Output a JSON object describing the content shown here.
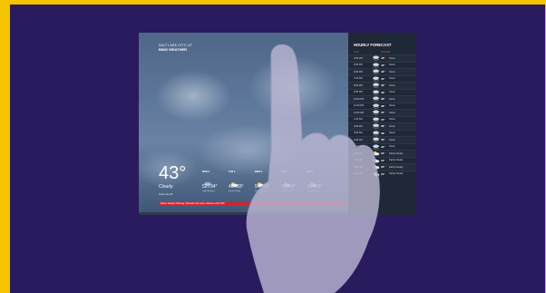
{
  "location": {
    "subtitle": "SALT LAKE CITY, UT",
    "title": "BING WEATHER"
  },
  "current": {
    "temp": "43°",
    "condition": "Cloudy",
    "details": "Feels Like 43°"
  },
  "days": [
    {
      "name": "MON 3",
      "temp": "52°/34°",
      "desc": "Light Showers",
      "icon": "rain-icon"
    },
    {
      "name": "TUE 4",
      "temp": "46°/33°",
      "desc": "Partly Cloudy",
      "icon": "partly-cloudy-icon"
    },
    {
      "name": "WED 5",
      "temp": "54°/40°",
      "desc": "Partly Cloudy",
      "icon": "partly-cloudy-icon"
    },
    {
      "name": "THU 6",
      "temp": "55°/36°",
      "desc": "Partly Cloudy",
      "icon": "partly-cloudy-icon"
    },
    {
      "name": "FRI 7",
      "temp": "63°/39°",
      "desc": "Partly Cloudy",
      "icon": "partly-cloudy-icon"
    }
  ],
  "alert": "Winter Weather Warning: Salt Lake City metro, effective until 5 PM",
  "hourly": {
    "title": "HOURLY FORECAST",
    "headers": [
      "Time",
      "Forecast"
    ],
    "rows": [
      {
        "time": "4:00 PM",
        "temp": "43°",
        "cond": "Snow",
        "icon": "snow-icon"
      },
      {
        "time": "5:00 PM",
        "temp": "43°",
        "cond": "Snow",
        "icon": "snow-icon"
      },
      {
        "time": "6:00 PM",
        "temp": "42°",
        "cond": "Snow",
        "icon": "snow-icon"
      },
      {
        "time": "7:00 PM",
        "temp": "41°",
        "cond": "Snow",
        "icon": "snow-icon"
      },
      {
        "time": "8:00 PM",
        "temp": "40°",
        "cond": "Snow",
        "icon": "snow-icon"
      },
      {
        "time": "9:00 PM",
        "temp": "39°",
        "cond": "Snow",
        "icon": "snow-icon"
      },
      {
        "time": "10:00 PM",
        "temp": "38°",
        "cond": "Snow",
        "icon": "snow-icon"
      },
      {
        "time": "11:00 PM",
        "temp": "38°",
        "cond": "Snow",
        "icon": "snow-icon"
      },
      {
        "time": "12:00 AM",
        "temp": "37°",
        "cond": "Snow",
        "icon": "snow-icon"
      },
      {
        "time": "1:00 AM",
        "temp": "37°",
        "cond": "Snow",
        "icon": "snow-icon"
      },
      {
        "time": "2:00 AM",
        "temp": "36°",
        "cond": "Snow",
        "icon": "snow-icon"
      },
      {
        "time": "3:00 AM",
        "temp": "36°",
        "cond": "Snow",
        "icon": "snow-icon"
      },
      {
        "time": "4:00 AM",
        "temp": "35°",
        "cond": "Snow",
        "icon": "snow-icon"
      },
      {
        "time": "5:00 AM",
        "temp": "35°",
        "cond": "Snow",
        "icon": "snow-icon"
      },
      {
        "time": "6:00 AM",
        "temp": "34°",
        "cond": "Partly Cloudy",
        "icon": "partly-cloudy-icon"
      },
      {
        "time": "7:00 AM",
        "temp": "34°",
        "cond": "Partly Cloudy",
        "icon": "partly-cloudy-icon"
      },
      {
        "time": "8:00 AM",
        "temp": "35°",
        "cond": "Partly Cloudy",
        "icon": "partly-cloudy-icon"
      },
      {
        "time": "9:00 AM",
        "temp": "37°",
        "cond": "Partly Cloudy",
        "icon": "partly-cloudy-icon"
      }
    ]
  },
  "colors": {
    "background": "#f5c400",
    "frame": "#2a1a5e",
    "alert": "#d8222a",
    "accent": "#e4742c"
  }
}
